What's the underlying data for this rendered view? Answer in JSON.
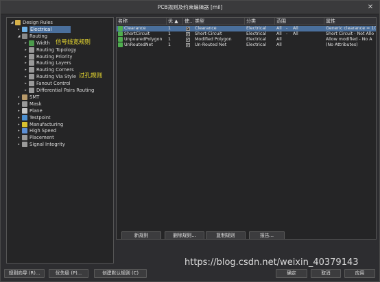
{
  "window": {
    "title": "PCB规则及约束编辑器 [mil]",
    "close_glyph": "✕"
  },
  "tree": [
    {
      "label": "Design Rules",
      "arrow": "◢",
      "icon_color": "#d7b24a",
      "level": 0
    },
    {
      "label": "Electrical",
      "arrow": "▸",
      "icon_color": "#6fb2e8",
      "level": 1,
      "selected": true
    },
    {
      "label": "Routing",
      "arrow": "◢",
      "icon_color": "#8a8a8a",
      "level": 1
    },
    {
      "label": "Width",
      "arrow": "▸",
      "icon_color": "#4c9b4c",
      "level": 2
    },
    {
      "label": "Routing Topology",
      "arrow": "▸",
      "icon_color": "#9a9a9a",
      "level": 2
    },
    {
      "label": "Routing Priority",
      "arrow": "▸",
      "icon_color": "#9a9a9a",
      "level": 2
    },
    {
      "label": "Routing Layers",
      "arrow": "▸",
      "icon_color": "#9a9a9a",
      "level": 2
    },
    {
      "label": "Routing Corners",
      "arrow": "▸",
      "icon_color": "#9a9a9a",
      "level": 2
    },
    {
      "label": "Routing Via Style",
      "arrow": "▸",
      "icon_color": "#9a9a9a",
      "level": 2
    },
    {
      "label": "Fanout Control",
      "arrow": "▸",
      "icon_color": "#9a9a9a",
      "level": 2
    },
    {
      "label": "Differential Pairs Routing",
      "arrow": "▸",
      "icon_color": "#9a9a9a",
      "level": 2
    },
    {
      "label": "SMT",
      "arrow": "▸",
      "icon_color": "#b89a6a",
      "level": 1
    },
    {
      "label": "Mask",
      "arrow": "▸",
      "icon_color": "#9a9a9a",
      "level": 1
    },
    {
      "label": "Plane",
      "arrow": "▸",
      "icon_color": "#c8c8c8",
      "level": 1
    },
    {
      "label": "Testpoint",
      "arrow": "▸",
      "icon_color": "#4c8fd0",
      "level": 1
    },
    {
      "label": "Manufacturing",
      "arrow": "▸",
      "icon_color": "#d6c030",
      "level": 1
    },
    {
      "label": "High Speed",
      "arrow": "▸",
      "icon_color": "#5c8fd6",
      "level": 1
    },
    {
      "label": "Placement",
      "arrow": "▸",
      "icon_color": "#9a9a9a",
      "level": 1
    },
    {
      "label": "Signal Integrity",
      "arrow": "▸",
      "icon_color": "#9a9a9a",
      "level": 1
    }
  ],
  "notes": {
    "width": "信号线宽规则",
    "via": "过孔规则"
  },
  "table": {
    "columns": [
      "名称",
      "优 ▲",
      "使...",
      "类型",
      "分类",
      "范围",
      "",
      "",
      "属性"
    ],
    "rows": [
      {
        "name": "Clearance",
        "priority": "1",
        "enabled": "✓",
        "type": "Clearance",
        "category": "Electrical",
        "scope1": "All",
        "dash": "-",
        "scope2": "All",
        "attributes": "Generic clearance = 10",
        "selected": true
      },
      {
        "name": "ShortCircuit",
        "priority": "1",
        "enabled": "✓",
        "type": "Short-Circuit",
        "category": "Electrical",
        "scope1": "All",
        "dash": "-",
        "scope2": "All",
        "attributes": "Short Circuit - Not Allo"
      },
      {
        "name": "UnpouredPolygon",
        "priority": "1",
        "enabled": "✓",
        "type": "Modified Polygon",
        "category": "Electrical",
        "scope1": "All",
        "dash": "",
        "scope2": "",
        "attributes": "Allow modified - No  A"
      },
      {
        "name": "UnRoutedNet",
        "priority": "1",
        "enabled": "✓",
        "type": "Un-Routed Net",
        "category": "Electrical",
        "scope1": "All",
        "dash": "",
        "scope2": "",
        "attributes": "(No Attributes)"
      }
    ]
  },
  "table_buttons": {
    "new_rule": "新规则",
    "delete_rule": "删除规则...",
    "copy_rule": "复制规则",
    "report": "报告..."
  },
  "footer_buttons": {
    "wizard": "规则向导 (R)...",
    "priority": "优先级 (P)...",
    "create_default": "创建默认规则 (C)",
    "ok": "确定",
    "cancel": "取消",
    "apply": "应用"
  },
  "watermark": "https://blog.csdn.net/weixin_40379143"
}
